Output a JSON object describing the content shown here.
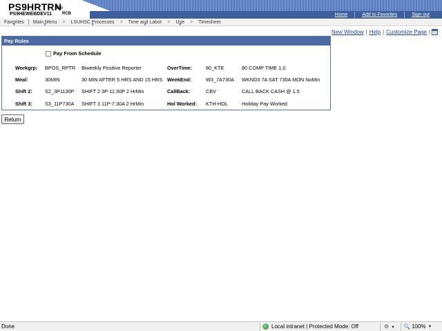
{
  "header": {
    "system": "PS9HRTRN",
    "version": "8.50",
    "database": "PS9HEWEBDEV11",
    "user": "RCB",
    "links": [
      "Home",
      "Add to Favorites",
      "Sign out"
    ]
  },
  "menubar": {
    "favorites": "Favorites",
    "main_menu": "Main Menu",
    "breadcrumbs": [
      "LSUHSC Processes",
      "Time and Labor",
      "Use",
      "Timesheet"
    ]
  },
  "page_links": {
    "new_window": "New Window",
    "help": "Help",
    "customize_page": "Customize Page",
    "sep": "|"
  },
  "pay_rules": {
    "title": "Pay Rules",
    "pay_from_schedule": "Pay From Schedule",
    "left": [
      {
        "label": "Workgrp:",
        "code": "BPOS_RPTR",
        "desc": "Biweekly Positive Reporter"
      },
      {
        "label": "Meal:",
        "code": "30MIN",
        "desc": "30 MIN AFTER 5 HRS AND 15 HRS"
      },
      {
        "label": "Shift 2:",
        "code": "S2_3P1130P",
        "desc": "SHIFT 2 3P-11:30P 2 HrMin"
      },
      {
        "label": "Shift 3:",
        "code": "S3_11P730A",
        "desc": "SHIFT 3 11P-7:30A 2 HrMin"
      }
    ],
    "right": [
      {
        "label": "OverTime:",
        "code": "80_KTE",
        "desc": "80 COMP TIME 1.0"
      },
      {
        "label": "WeekEnd:",
        "code": "W3_7A730A",
        "desc": "WKND3 7A SAT 730A MON NoMin"
      },
      {
        "label": "CallBack:",
        "code": "CBV",
        "desc": "CALL BACK CASH @ 1.5"
      },
      {
        "label": "Hol Worked:",
        "code": "KTH-HOL",
        "desc": "Holiday Pay Worked"
      }
    ]
  },
  "return_button": "Return",
  "statusbar": {
    "status": "Done",
    "zone": "Local intranet | Protected Mode: Off",
    "zoom": "100%"
  },
  "icons": {
    "grid": "grid-icon",
    "globe": "globe-icon",
    "gear": "gear-icon",
    "zoom": "zoom-icon"
  },
  "colors": {
    "header_band": "#3e5f9c",
    "title_bar": "#4e6aa4",
    "link": "#1f3f99"
  }
}
